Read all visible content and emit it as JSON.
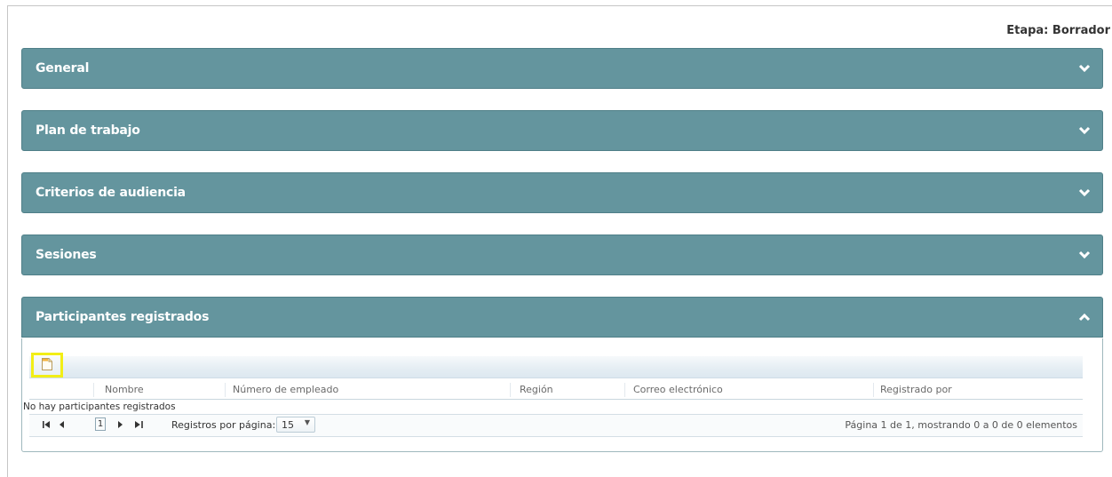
{
  "stage": "Etapa: Borrador",
  "panels": [
    {
      "title": "General",
      "chevron": "chevron-down"
    },
    {
      "title": "Plan de trabajo",
      "chevron": "chevron-down"
    },
    {
      "title": "Criterios de audiencia",
      "chevron": "chevron-down"
    },
    {
      "title": "Sesiones",
      "chevron": "chevron-down"
    },
    {
      "title": "Participantes registrados",
      "chevron": "chevron-up"
    }
  ],
  "grid": {
    "add_icon": "new-record-icon",
    "columns": [
      "Nombre",
      "Número de empleado",
      "Región",
      "Correo electrónico",
      "Registrado por"
    ],
    "empty_message": "No hay participantes registrados",
    "pager": {
      "current_page": "1",
      "records_per_page_label": "Registros por página:",
      "records_per_page_value": "15",
      "info": "Página 1 de 1, mostrando 0 a 0 de 0 elementos"
    }
  },
  "colors": {
    "panel_header": "#64959e",
    "highlight": "#f2ee16"
  }
}
